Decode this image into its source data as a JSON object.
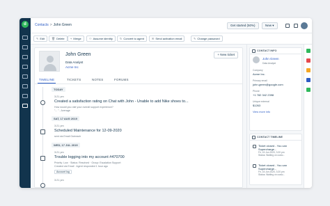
{
  "rail": {
    "logo_text": "d"
  },
  "header": {
    "breadcrumb": {
      "parent": "Contacts",
      "separator": ">",
      "current": "John Green"
    },
    "get_started_label": "Get started (50%)",
    "new_label": "New ▾"
  },
  "toolbar": {
    "actions": [
      {
        "glyph": "✎",
        "label": "Edit"
      },
      {
        "glyph": "🗑",
        "label": "Delete"
      },
      {
        "glyph": "⑂",
        "label": "Merge"
      },
      {
        "glyph": "⚇",
        "label": "Assume identity"
      },
      {
        "glyph": "↻",
        "label": "Convert to agent"
      },
      {
        "glyph": "✉",
        "label": "Send activation email"
      },
      {
        "glyph": "✎",
        "label": "Change password"
      }
    ]
  },
  "contact": {
    "name": "John Green",
    "title": "Data Analyst",
    "company": "Acme Inc",
    "new_ticket_label": "+ New ticket"
  },
  "tabs": [
    "TIMELINE",
    "TICKETS",
    "NOTES",
    "FORUMS"
  ],
  "timeline": {
    "groups": [
      {
        "day": "TODAY"
      },
      {
        "day": "SAT, 17 AUG 2019"
      },
      {
        "day": "WED, 17 JUL 2019"
      }
    ],
    "events": [
      {
        "time": "3:21 pm",
        "title": "Created a satisfaction rating on Chat with John - Unable to add Nike shoes to...",
        "meta": "How would you rate your overall support experience?",
        "meta2": "\"... \" - Average"
      },
      {
        "time": "3:21 pm",
        "title": "Scheduled Maintenance for 12-09-2020",
        "meta": "sent via Email Outreach"
      },
      {
        "time": "3:21 pm",
        "title": "Trouble logging into my account #470700",
        "meta": "Priority: Low  ·  Status: Resolved  ·  Group: Escalation Support",
        "meta2": "Created via Email  ·  Agent responded 1 hour ago",
        "tag": "Account log"
      },
      {
        "time": "3:21 pm"
      }
    ]
  },
  "contact_info": {
    "heading": "CONTACT INFO",
    "name": "John Green",
    "title": "Data Analyst",
    "fields": [
      {
        "label": "Company",
        "value": "Acme Inc."
      },
      {
        "label": "Primary email",
        "value": "john.green@google.com"
      },
      {
        "label": "Phone",
        "value": "+1 782 342 2398"
      },
      {
        "label": "Unique external",
        "value": "$1263"
      }
    ],
    "view_more": "View more info"
  },
  "contact_timeline": {
    "heading": "CONTACT TIMELINE",
    "items": [
      {
        "line1": "Ticket closed - You can",
        "line2": "Supercharge...",
        "date": "Fri, 15 Jun 2020, 3:20 pm",
        "status": "Status: Waiting on custo..."
      },
      {
        "line1": "Ticket closed - You can",
        "line2": "Supercharge...",
        "date": "Fri, 15 Jun 2020, 3:20 pm",
        "status": "Status: Waiting on custo..."
      }
    ]
  },
  "colors": {
    "accent": "#2c5cc5",
    "rail": "#12344d",
    "brand_green": "#2fb85c"
  },
  "app_icons": [
    {
      "name": "whatsapp-app-icon",
      "color": "#2fb85c"
    },
    {
      "name": "grid-app-icon",
      "color": "#e5484d"
    },
    {
      "name": "chat-app-icon",
      "color": "#f5a623"
    },
    {
      "name": "diamond-app-icon",
      "color": "#2c5cc5"
    },
    {
      "name": "phone-app-icon",
      "color": "#2fb85c"
    }
  ]
}
